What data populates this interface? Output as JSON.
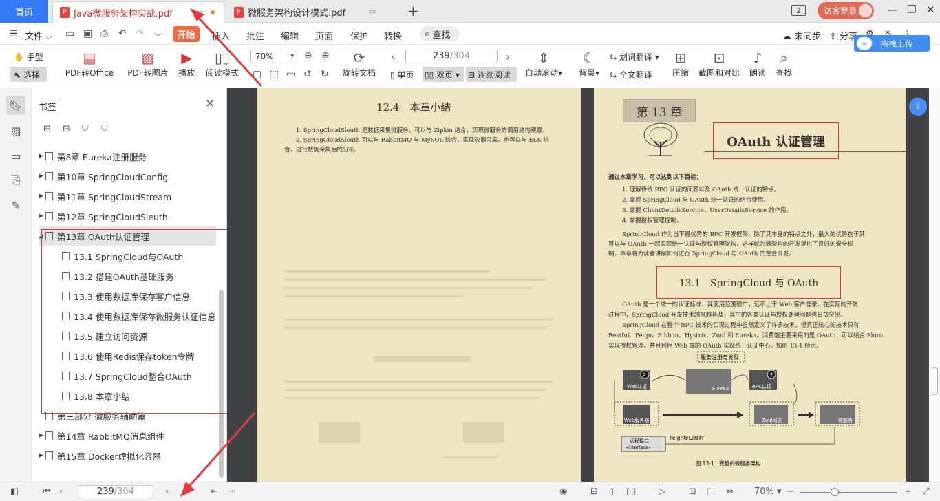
{
  "tabbar": {
    "home": "首页",
    "tabs": [
      {
        "label": "Java微服务架构实战.pdf",
        "active": true,
        "icon": "pdf-icon"
      },
      {
        "label": "微服务架构设计模式.pdf",
        "active": false,
        "icon": "pdf-icon"
      }
    ],
    "add": "+",
    "page_badge": "2",
    "login": "访客登录"
  },
  "menubar": {
    "file": "文件",
    "items": [
      "开始",
      "插入",
      "批注",
      "编辑",
      "页面",
      "保护",
      "转换"
    ],
    "search": "查找",
    "sync": "未同步",
    "share": "分享"
  },
  "toolbar": {
    "hand": "手型",
    "select": "选择",
    "pdf_to_office": "PDF转Office",
    "pdf_to_image": "PDF转图片",
    "play": "播放",
    "read_mode": "阅读模式",
    "zoom": "70%",
    "rotate": "旋转文档",
    "page_current": "239",
    "page_total": "/304",
    "single": "单页",
    "double": "双页",
    "continuous": "连续阅读",
    "auto_scroll": "自动滚动",
    "background": "背景",
    "word_translate": "划词翻译",
    "full_translate": "全文翻译",
    "compress": "压缩",
    "compare": "截图和对比",
    "read_aloud": "朗读",
    "find": "查找",
    "upload": "拖拽上传"
  },
  "sidebar": {
    "title": "书签",
    "bookmarks": [
      {
        "label": "第8章 Eureka注册服务",
        "level": 0,
        "caret": "▶"
      },
      {
        "label": "第10章 SpringCloudConfig",
        "level": 0,
        "caret": "▶"
      },
      {
        "label": "第11章 SpringCloudStream",
        "level": 0,
        "caret": "▶"
      },
      {
        "label": "第12章 SpringCloudSleuth",
        "level": 0,
        "caret": "▶"
      },
      {
        "label": "第13章 OAuth认证管理",
        "level": 0,
        "caret": "◢",
        "selected": true
      },
      {
        "label": "13.1 SpringCloud与OAuth",
        "level": 1,
        "caret": ""
      },
      {
        "label": "13.2 搭建OAuth基础服务",
        "level": 1,
        "caret": ""
      },
      {
        "label": "13.3 使用数据库保存客户信息",
        "level": 1,
        "caret": ""
      },
      {
        "label": "13.4 使用数据库保存微服务认证信息",
        "level": 1,
        "caret": ""
      },
      {
        "label": "13.5 建立访问资源",
        "level": 1,
        "caret": ""
      },
      {
        "label": "13.6 使用Redis保存token令牌",
        "level": 1,
        "caret": ""
      },
      {
        "label": "13.7 SpringCloud整合OAuth",
        "level": 1,
        "caret": ""
      },
      {
        "label": "13.8 本章小结",
        "level": 1,
        "caret": ""
      },
      {
        "label": "第三部分 微服务辅助篇",
        "level": 0,
        "caret": ""
      },
      {
        "label": "第14章 RabbitMQ消息组件",
        "level": 0,
        "caret": "▶"
      },
      {
        "label": "第15章 Docker虚拟化容器",
        "level": 0,
        "caret": "▶"
      }
    ]
  },
  "page_left": {
    "heading": "12.4　本章小结",
    "para1": "1. SpringCloudSleuth 是数据采集微服务，可以与 Zipkin 结合，实现微服务的调用结构观察。",
    "para2": "2. SpringCloudSleuth 可以与 RabbitMQ 与 MySQL 结合，实现数据采集。也可以与 ELK 结合，进行数据采集后的分析。"
  },
  "page_right": {
    "chapter": "第 13 章",
    "title": "OAuth 认证管理",
    "goals_intro": "通过本章学习，可以达到以下目标：",
    "goals": [
      "1. 理解传统 RPC 认证的问题以及 OAuth 统一认证的特点。",
      "2. 掌握 SpringCloud 与 OAuth 统一认证的结合使用。",
      "3. 掌握 ClientDetailsService、UserDetailsService 的作用。",
      "4. 掌握授权管理控制。"
    ],
    "intro_lines": [
      "SpringCloud 作为当下最优秀的 RPC 开发框架，除了其本身的特点之外，最大的优势在于其",
      "可以与 OAuth 一起实现统一认证与授权管理架构，这样就为微架构的开发提供了良好的安全机",
      "制。本章将为读者讲解如何进行 SpringCloud 与 OAuth 的整合开发。"
    ],
    "section": "13.1　SpringCloud 与 OAuth",
    "body_lines": [
      "OAuth 是一个统一的认证标准，其使用范围很广，远不止于 Web 客户登录。在实际的开发",
      "过程中，SpringCloud 开发技术越来越普及，其中的各类认证与授权处理问题也日益突出。",
      "SpringCloud 在整个 RPC 技术的实现过程中虽然定义了许多技术，但真正核心的技术只有",
      "Restful、Feign、Ribbon、Hystrix、Zuul 和 Eureka。消费端主要采用的是 OAuth，可以结合 Shiro",
      "实现授权管理，并且利用 Web 端的 OAuth 实现统一认证中心，如图 13-1 所示。"
    ],
    "diagram": {
      "reg": "服务注册与发现",
      "web_auth": "Web认证",
      "eureka": "Eureka",
      "rpc_auth": "RPC认证",
      "web_server": "Web服务器",
      "zuul": "Zuul网关",
      "microservice": "微服务",
      "remote_interface": "远程接口",
      "interface": "«interface»",
      "feign": "Feign接口映射",
      "caption": "图 13-1　完整的微服务架构",
      "num1": "1",
      "num2": "2"
    }
  },
  "statusbar": {
    "page_current": "239",
    "page_total": "/304",
    "zoom": "70%",
    "minus": "−",
    "plus": "+"
  },
  "colors": {
    "accent": "#3479f5",
    "start": "#f06a3f",
    "tab_active_text": "#c8342e",
    "annotation_red": "#e03a3a",
    "page_bg": "#f0e5c1"
  }
}
